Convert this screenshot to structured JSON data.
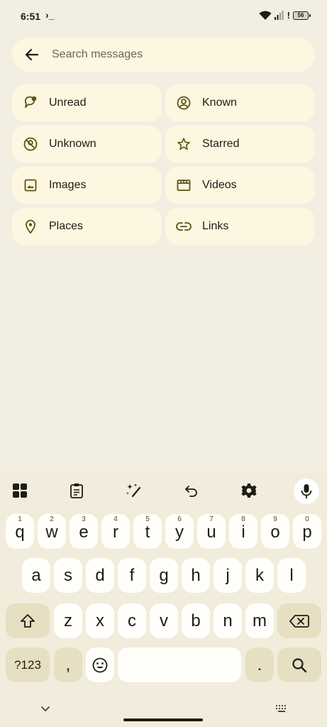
{
  "status": {
    "time": "6:51",
    "terminal_glyph": "›_",
    "battery": "56"
  },
  "search": {
    "placeholder": "Search messages"
  },
  "chips": [
    {
      "label": "Unread",
      "icon": "unread-icon"
    },
    {
      "label": "Known",
      "icon": "person-circle-icon"
    },
    {
      "label": "Unknown",
      "icon": "unknown-person-icon"
    },
    {
      "label": "Starred",
      "icon": "star-icon"
    },
    {
      "label": "Images",
      "icon": "image-icon"
    },
    {
      "label": "Videos",
      "icon": "video-icon"
    },
    {
      "label": "Places",
      "icon": "location-pin-icon"
    },
    {
      "label": "Links",
      "icon": "link-icon"
    }
  ],
  "keyboard": {
    "row1": [
      {
        "k": "q",
        "h": "1"
      },
      {
        "k": "w",
        "h": "2"
      },
      {
        "k": "e",
        "h": "3"
      },
      {
        "k": "r",
        "h": "4"
      },
      {
        "k": "t",
        "h": "5"
      },
      {
        "k": "y",
        "h": "6"
      },
      {
        "k": "u",
        "h": "7"
      },
      {
        "k": "i",
        "h": "8"
      },
      {
        "k": "o",
        "h": "9"
      },
      {
        "k": "p",
        "h": "0"
      }
    ],
    "row2": [
      "a",
      "s",
      "d",
      "f",
      "g",
      "h",
      "j",
      "k",
      "l"
    ],
    "row3": [
      "z",
      "x",
      "c",
      "v",
      "b",
      "n",
      "m"
    ],
    "symbols_label": "?123",
    "comma": ",",
    "period": "."
  },
  "colors": {
    "accent": "#5b5316",
    "key_bg": "#fffefa",
    "mod_bg": "#e6dfc2",
    "chip_bg": "#fdf7e1"
  }
}
